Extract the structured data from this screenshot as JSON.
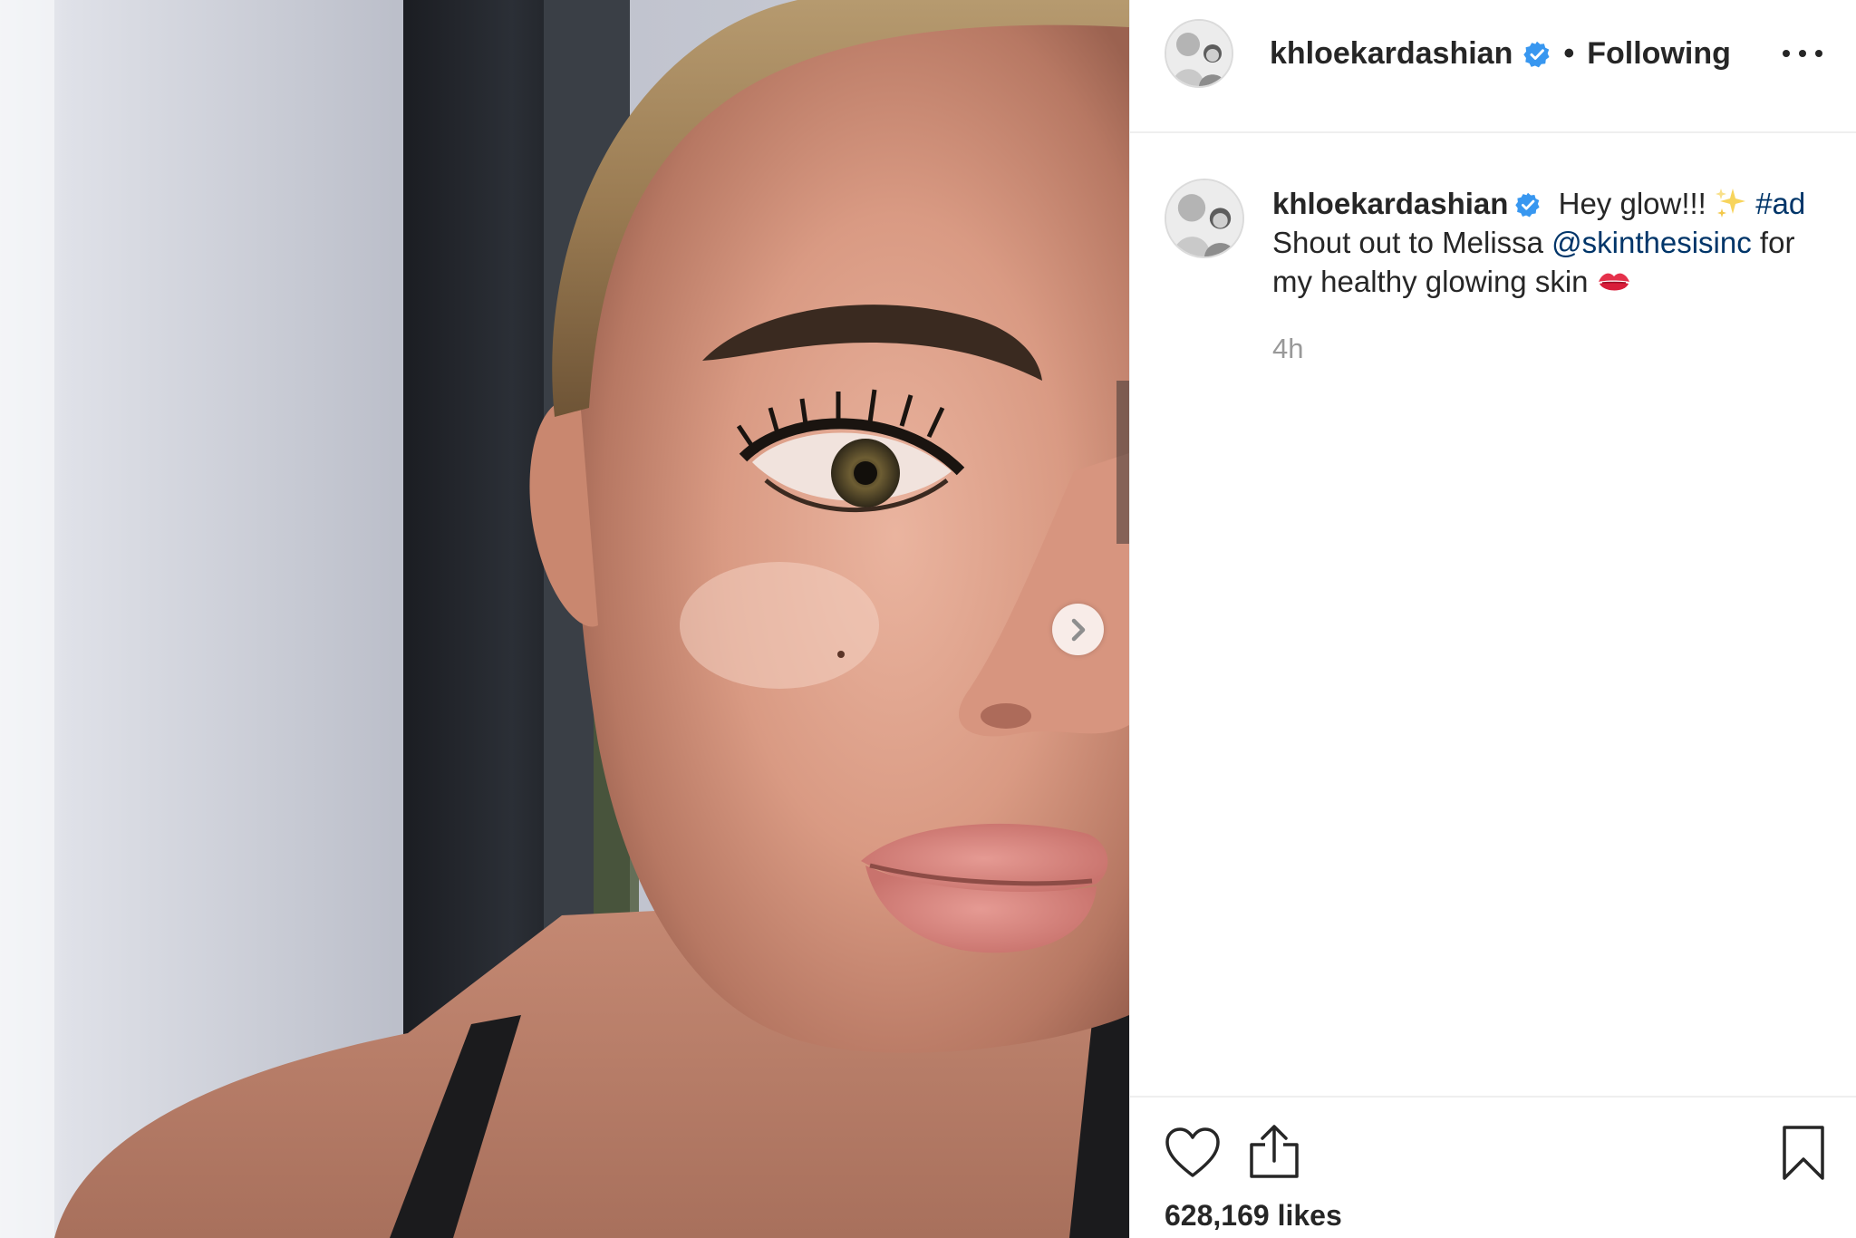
{
  "post": {
    "username": "khloekardashian",
    "follow_status": "Following",
    "separator": "•",
    "caption": {
      "username": "khloekardashian",
      "text_1": " Hey glow!!! ",
      "hashtag": "#ad",
      "text_2": " Shout out to Melissa ",
      "mention": "@skinthesisinc",
      "text_3": " for my healthy glowing skin "
    },
    "timestamp": "4h",
    "likes": "628,169 likes"
  },
  "icons": {
    "verified": "verified-badge-icon",
    "sparkles": "sparkles-emoji",
    "kiss": "kiss-mark-emoji",
    "next": "chevron-right-icon",
    "more": "more-options-icon",
    "like": "heart-icon",
    "share": "share-icon",
    "save": "bookmark-icon"
  },
  "colors": {
    "verified_blue": "#3897f0",
    "link_blue": "#003569",
    "text": "#262626",
    "muted": "#999999",
    "divider": "#efefef"
  }
}
